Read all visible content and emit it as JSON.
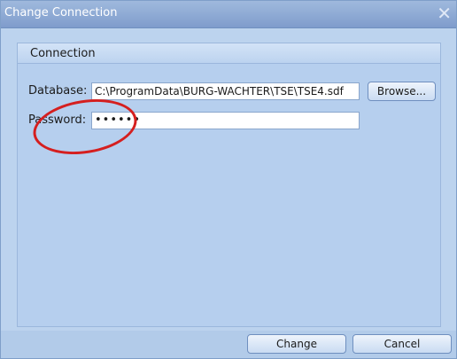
{
  "window": {
    "title": "Change Connection",
    "close_glyph": "✕"
  },
  "group": {
    "title": "Connection"
  },
  "database": {
    "label": "Database:",
    "value": "C:\\ProgramData\\BURG-WACHTER\\TSE\\TSE4.sdf",
    "browse_label": "Browse..."
  },
  "password": {
    "label": "Password:",
    "value": "••••••"
  },
  "buttons": {
    "change_label": "Change",
    "cancel_label": "Cancel"
  },
  "annotation": {
    "highlight_color": "#d51f1f"
  }
}
